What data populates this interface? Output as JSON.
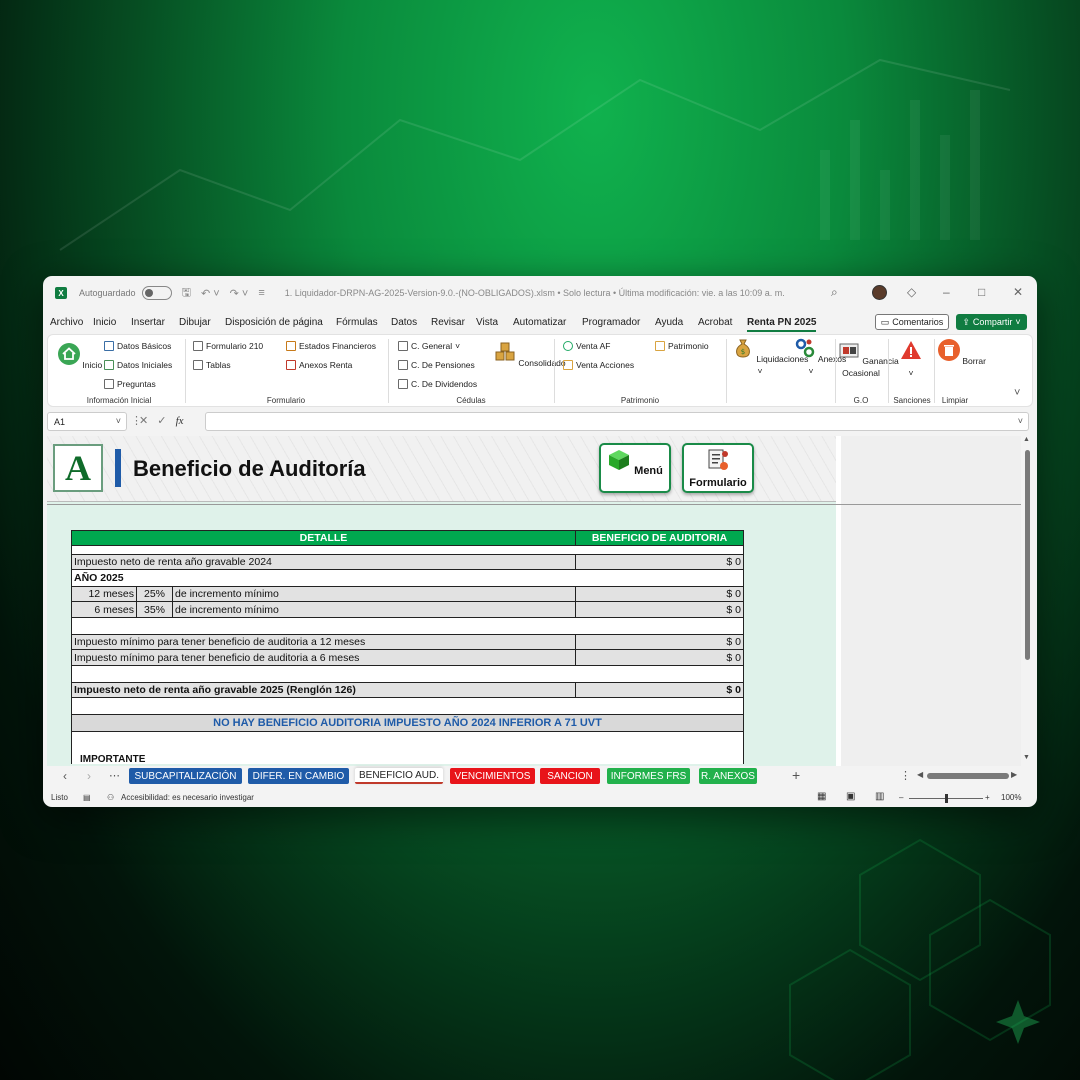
{
  "window": {
    "autosave_label": "Autoguardado",
    "doc_title": "1. Liquidador-DRPN-AG-2025-Version-9.0.-(NO-OBLIGADOS).xlsm  •  Solo lectura  •  Última modificación: vie. a las 10:09 a. m."
  },
  "menu": [
    "Archivo",
    "Inicio",
    "Insertar",
    "Dibujar",
    "Disposición de página",
    "Fórmulas",
    "Datos",
    "Revisar",
    "Vista",
    "Automatizar",
    "Programador",
    "Ayuda",
    "Acrobat",
    "Renta PN 2025"
  ],
  "menu_actions": {
    "comentarios": "Comentarios",
    "compartir": "Compartir"
  },
  "ribbon": {
    "inicio": "Inicio",
    "datos_basicos": "Datos Básicos",
    "datos_iniciales": "Datos Iniciales",
    "preguntas": "Preguntas",
    "group_info": "Información Inicial",
    "formulario_210": "Formulario 210",
    "tablas": "Tablas",
    "estados_financieros": "Estados Financieros",
    "anexos_renta": "Anexos Renta",
    "group_formulario": "Formulario",
    "c_general": "C. General",
    "c_pensiones": "C. De Pensiones",
    "c_dividendos": "C. De Dividendos",
    "consolidado": "Consolidado",
    "group_cedulas": "Cédulas",
    "venta_af": "Venta AF",
    "venta_acciones": "Venta Acciones",
    "patrimonio": "Patrimonio",
    "group_patrimonio": "Patrimonio",
    "liquidaciones": "Liquidaciones",
    "anexos": "Anexos",
    "ganancia": "Ganancia",
    "ocasional": "Ocasional",
    "group_go": "G.O",
    "group_sanciones": "Sanciones",
    "borrar": "Borrar",
    "group_limpiar": "Limpiar"
  },
  "formula_bar": {
    "cell": "A1",
    "fx": "fx"
  },
  "header": {
    "logo": "A",
    "title": "Beneficio de Auditoría",
    "menu_button": "Menú",
    "form_button": "Formulario"
  },
  "table": {
    "col_detalle": "DETALLE",
    "col_beneficio": "BENEFICIO DE AUDITORIA",
    "r1_label": "Impuesto neto de renta año gravable 2024",
    "r1_value": "$ 0",
    "year_label": "AÑO 2025",
    "r2_months": "12 meses",
    "r2_pct": "25%",
    "r2_desc": "de incremento mínimo",
    "r2_value": "$ 0",
    "r3_months": "6 meses",
    "r3_pct": "35%",
    "r3_desc": "de incremento mínimo",
    "r3_value": "$ 0",
    "r4_label": "Impuesto mínimo para tener beneficio de auditoria a 12 meses",
    "r4_value": "$ 0",
    "r5_label": "Impuesto mínimo para tener beneficio de auditoria a 6 meses",
    "r5_value": "$ 0",
    "r6_label": "Impuesto neto de renta año gravable 2025 (Renglón 126)",
    "r6_value": "$ 0",
    "banner": "NO HAY BENEFICIO AUDITORIA IMPUESTO AÑO 2024 INFERIOR A 71 UVT",
    "importante": "IMPORTANTE"
  },
  "tabs": [
    {
      "label": "SUBCAPITALIZACIÓN",
      "color": "#1f5ba8"
    },
    {
      "label": "DIFER. EN CAMBIO",
      "color": "#1f5ba8"
    },
    {
      "label": "BENEFICIO AUD.",
      "color": "#ffffff"
    },
    {
      "label": "VENCIMIENTOS",
      "color": "#e8141a"
    },
    {
      "label": "SANCION",
      "color": "#e8141a"
    },
    {
      "label": "INFORMES FRS",
      "color": "#22b14c"
    },
    {
      "label": "R. ANEXOS",
      "color": "#22b14c"
    }
  ],
  "status": {
    "ready": "Listo",
    "accessibility": "Accesibilidad: es necesario investigar",
    "zoom": "100%"
  }
}
